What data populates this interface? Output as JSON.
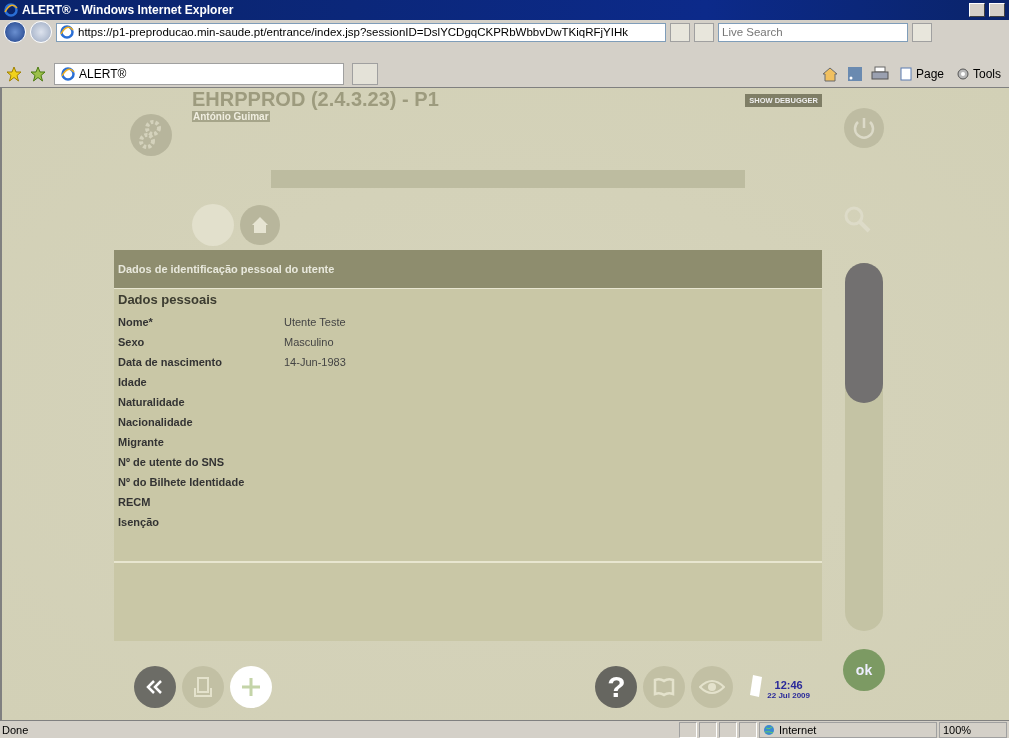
{
  "window": {
    "title": "ALERT® - Windows Internet Explorer"
  },
  "address_bar": {
    "url": "https://p1-preproducao.min-saude.pt/entrance/index.jsp?sessionID=DslYCDgqCKPRbWbbvDwTKiqRFjYIHk"
  },
  "search": {
    "placeholder": "Live Search"
  },
  "tabs": [
    {
      "label": "ALERT®",
      "selected": true
    }
  ],
  "toolbar": [
    "Page",
    "Tools"
  ],
  "app": {
    "title": "EHRPPROD (2.4.3.23) - P1",
    "user": "António Guimar",
    "debug_button": "SHOW DEBUGGER"
  },
  "panel": {
    "title": "Dados de identificação pessoal do utente",
    "section": "Dados pessoais",
    "fields": [
      {
        "label": "Nome*",
        "value": "Utente Teste"
      },
      {
        "label": "Sexo",
        "value": "Masculino"
      },
      {
        "label": "Data de nascimento",
        "value": "14-Jun-1983"
      },
      {
        "label": "Idade"
      },
      {
        "label": "Naturalidade"
      },
      {
        "label": "Nacionalidade"
      },
      {
        "label": "Migrante"
      },
      {
        "label": "Nº de utente do SNS"
      },
      {
        "label": "Nº do Bilhete Identidade"
      },
      {
        "label": "RECM"
      },
      {
        "label": "Isenção"
      }
    ]
  },
  "help_button": "?",
  "clock": {
    "time": "12:46",
    "date": "22 Jul 2009"
  },
  "ok_button": "ok",
  "status_bar": {
    "text": "Done",
    "zone": "Internet",
    "zoom": "100%"
  }
}
